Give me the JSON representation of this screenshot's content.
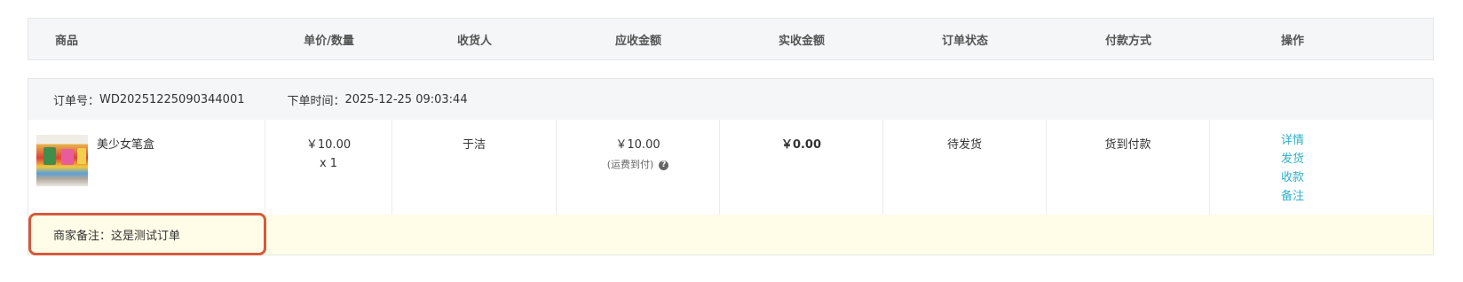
{
  "table_header": {
    "goods": "商品",
    "price_qty": "单价/数量",
    "receiver": "收货人",
    "amount_due": "应收金额",
    "amount_paid": "实收金额",
    "order_status": "订单状态",
    "payment_method": "付款方式",
    "actions": "操作"
  },
  "order": {
    "order_no_label": "订单号：",
    "order_no": "WD20251225090344001",
    "order_time_label": "下单时间：",
    "order_time": "2025-12-25 09:03:44",
    "product_name": "美少女笔盒",
    "unit_price": "￥10.00",
    "quantity": "x 1",
    "receiver": "于洁",
    "amount_due": "￥10.00",
    "shipping_note": "(运费到付)",
    "amount_paid": "￥0.00",
    "status": "待发货",
    "payment_method": "货到付款",
    "actions": [
      "详情",
      "发货",
      "收款",
      "备注"
    ],
    "remark_label": "商家备注：",
    "remark_text": "这是测试订单"
  },
  "colors": {
    "header_bg": "#f5f6f7",
    "link": "#2fb1c9",
    "remark_bg": "#fffde8",
    "highlight_border": "#d55a3c"
  },
  "icons": {
    "help": "question-circle-icon",
    "product_image": "pencil-case-thumbnail"
  }
}
